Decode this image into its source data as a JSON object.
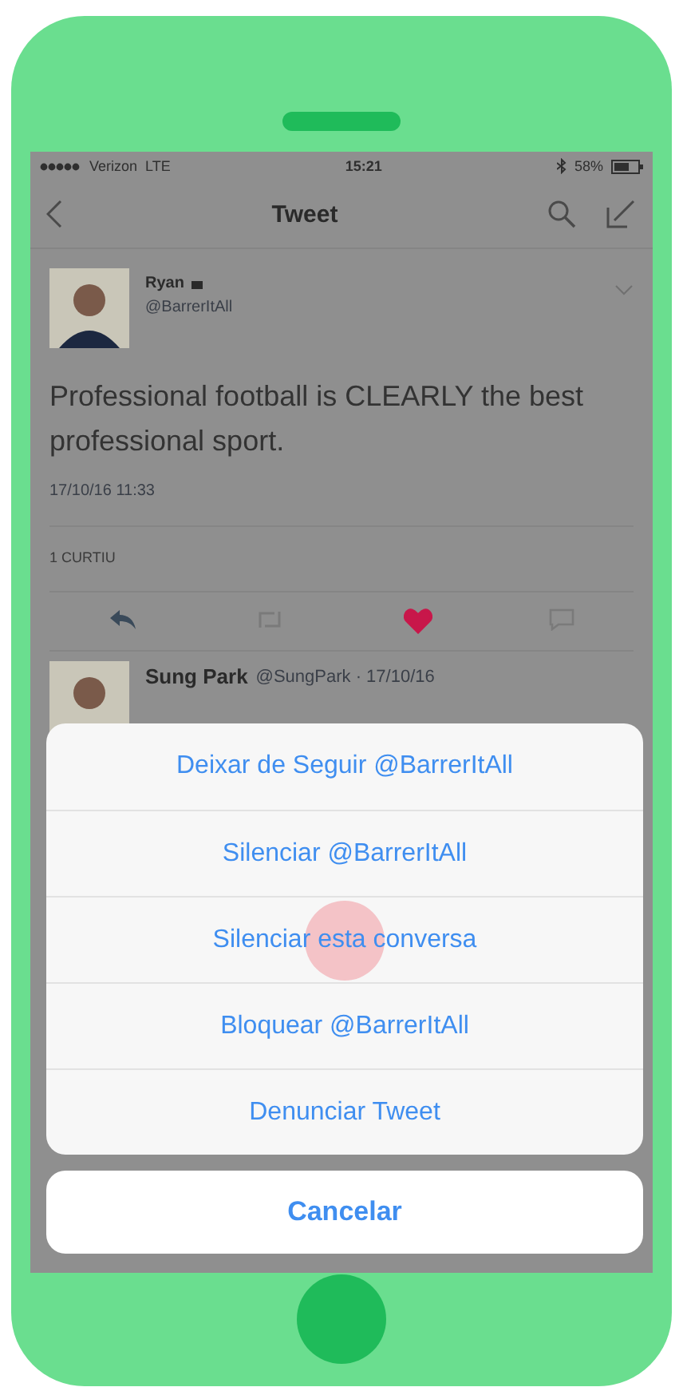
{
  "status_bar": {
    "carrier": "Verizon",
    "network": "LTE",
    "time": "15:21",
    "battery": "58%"
  },
  "nav": {
    "title": "Tweet"
  },
  "tweet": {
    "name": "Ryan",
    "handle": "@BarrerItAll",
    "text": "Professional football is CLEARLY the best professional sport.",
    "timestamp": "17/10/16 11:33",
    "likes": "1 CURTIU",
    "liked": true
  },
  "reply": {
    "name": "Sung Park",
    "meta": "@SungPark · 17/10/16"
  },
  "action_sheet": {
    "items": [
      {
        "label": "Deixar de Seguir @BarrerItAll",
        "pressed": false
      },
      {
        "label": "Silenciar @BarrerItAll",
        "pressed": false
      },
      {
        "label": "Silenciar esta conversa",
        "pressed": true
      },
      {
        "label": "Bloquear @BarrerItAll",
        "pressed": false
      },
      {
        "label": "Denunciar Tweet",
        "pressed": false
      }
    ],
    "cancel": "Cancelar"
  }
}
